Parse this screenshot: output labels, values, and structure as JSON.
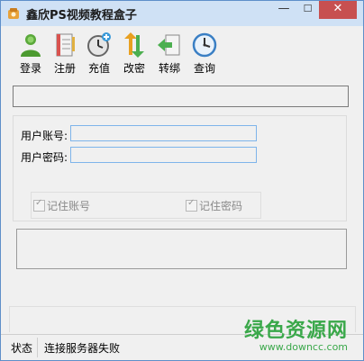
{
  "window": {
    "title": "鑫欣PS视频教程盒子",
    "controls": {
      "minimize": "—",
      "maximize": "☐",
      "close": "✕"
    }
  },
  "toolbar": {
    "items": [
      {
        "label": "登录",
        "icon": "user-login-icon"
      },
      {
        "label": "注册",
        "icon": "register-notebook-icon"
      },
      {
        "label": "充值",
        "icon": "recharge-clock-icon"
      },
      {
        "label": "改密",
        "icon": "change-password-arrows-icon"
      },
      {
        "label": "转绑",
        "icon": "rebind-arrow-icon"
      },
      {
        "label": "查询",
        "icon": "query-clock-icon"
      }
    ]
  },
  "login": {
    "account_label": "用户账号:",
    "account_value": "",
    "password_label": "用户密码:",
    "password_value": "",
    "remember_account": "记住账号",
    "remember_password": "记住密码",
    "remember_account_checked": true,
    "remember_password_checked": true
  },
  "status": {
    "label": "状态",
    "message": "连接服务器失败"
  },
  "watermark": {
    "title": "绿色资源网",
    "url": "www.downcc.com"
  },
  "colors": {
    "title_bar": "#cfe1f5",
    "close_button": "#c75050",
    "input_border": "#7eb4ea",
    "watermark": "#3aa84a"
  }
}
